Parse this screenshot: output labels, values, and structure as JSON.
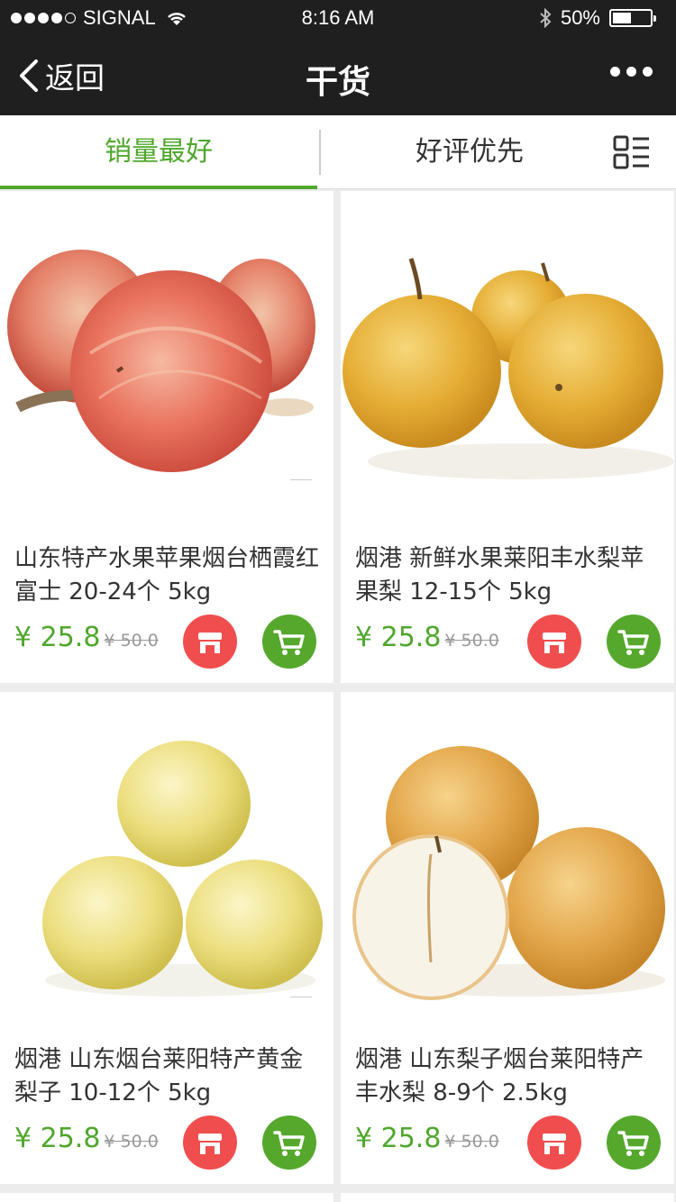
{
  "status_bar": {
    "carrier": "SIGNAL",
    "time": "8:16 AM",
    "battery": "50%",
    "battery_level": 0.5
  },
  "nav": {
    "back_label": "返回",
    "title": "干货"
  },
  "tabs": [
    {
      "label": "销量最好",
      "active": true
    },
    {
      "label": "好评优先",
      "active": false
    }
  ],
  "products": [
    {
      "title": "山东特产水果苹果烟台栖霞红富士 20-24个 5kg",
      "price": "¥ 25.8",
      "old_price": "¥ 50.0",
      "image": "red-apples"
    },
    {
      "title": "烟港 新鲜水果莱阳丰水梨苹果梨 12-15个 5kg",
      "price": "¥ 25.8",
      "old_price": "¥ 50.0",
      "image": "golden-pears"
    },
    {
      "title": "烟港 山东烟台莱阳特产黄金梨子 10-12个 5kg",
      "price": "¥ 25.8",
      "old_price": "¥ 50.0",
      "image": "yellow-pears"
    },
    {
      "title": "烟港 山东梨子烟台莱阳特产丰水梨 8-9个 2.5kg",
      "price": "¥ 25.8",
      "old_price": "¥ 50.0",
      "image": "sliced-pears"
    }
  ],
  "colors": {
    "accent": "#4fa72c",
    "shop_button": "#f04e4e",
    "cart_button": "#55a82c",
    "nav_bg": "#1f1f1f"
  }
}
